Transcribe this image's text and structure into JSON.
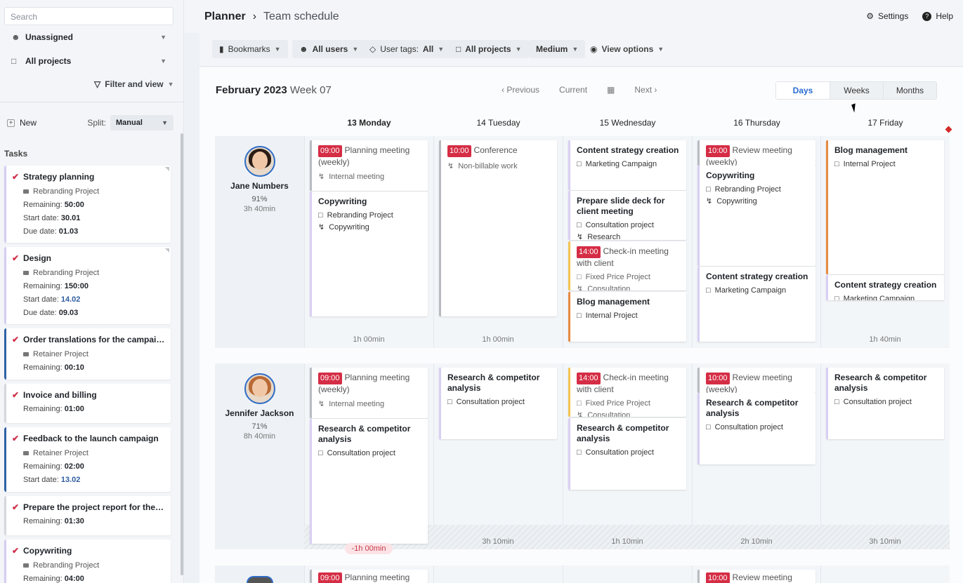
{
  "sidebar": {
    "search_placeholder": "Search",
    "user_filter": "Unassigned",
    "project_filter": "All projects",
    "filter_and_view": "Filter and view",
    "new_label": "New",
    "split_label": "Split:",
    "split_value": "Manual",
    "tasks_heading": "Tasks",
    "tasks": [
      {
        "title": "Strategy planning",
        "project": "Rebranding Project",
        "remaining_label": "Remaining:",
        "remaining": "50:00",
        "start_label": "Start date:",
        "start": "30.01",
        "due_label": "Due date:",
        "due": "01.03"
      },
      {
        "title": "Design",
        "project": "Rebranding Project",
        "remaining_label": "Remaining:",
        "remaining": "150:00",
        "start_label": "Start date:",
        "start": "14.02",
        "due_label": "Due date:",
        "due": "09.03"
      },
      {
        "title": "Order translations for the campaign ...",
        "project": "Retainer Project",
        "remaining_label": "Remaining:",
        "remaining": "00:10"
      },
      {
        "title": "Invoice and billing",
        "remaining_label": "Remaining:",
        "remaining": "01:00"
      },
      {
        "title": "Feedback to the launch campaign",
        "project": "Retainer Project",
        "remaining_label": "Remaining:",
        "remaining": "02:00",
        "start_label": "Start date:",
        "start": "13.02"
      },
      {
        "title": "Prepare the project report for the int...",
        "remaining_label": "Remaining:",
        "remaining": "01:30"
      },
      {
        "title": "Copywriting",
        "project": "Rebranding Project",
        "remaining_label": "Remaining:",
        "remaining": "04:00"
      }
    ]
  },
  "header": {
    "app": "Planner",
    "separator": "›",
    "page": "Team schedule",
    "settings": "Settings",
    "help": "Help"
  },
  "filters": {
    "bookmarks": "Bookmarks",
    "users": "All users",
    "user_tags_label": "User tags:",
    "user_tags_value": "All",
    "projects": "All projects",
    "density": "Medium",
    "view_options": "View options"
  },
  "calendar": {
    "month": "February 2023",
    "week": "Week 07",
    "previous": "Previous",
    "current": "Current",
    "next": "Next",
    "views": [
      "Days",
      "Weeks",
      "Months"
    ],
    "active_view": "Days",
    "days": [
      {
        "num": "13",
        "name": "Monday"
      },
      {
        "num": "14",
        "name": "Tuesday"
      },
      {
        "num": "15",
        "name": "Wednesday"
      },
      {
        "num": "16",
        "name": "Thursday"
      },
      {
        "num": "17",
        "name": "Friday"
      }
    ]
  },
  "people": [
    {
      "name": "Jane Numbers",
      "pct": "91%",
      "hours": "3h 40min",
      "footers": [
        "1h 00min",
        "1h 00min",
        "",
        "",
        "1h 40min"
      ]
    },
    {
      "name": "Jennifer Jackson",
      "pct": "71%",
      "hours": "8h 40min",
      "footers": [
        "-1h 00min",
        "3h 10min",
        "1h 10min",
        "2h 10min",
        "3h 10min"
      ]
    }
  ],
  "cards": {
    "planning": {
      "time": "09:00",
      "title": "Planning meeting (weekly)",
      "sub": "Internal meeting"
    },
    "copywriting": {
      "title": "Copywriting",
      "project": "Rebranding Project",
      "tag": "Copywriting"
    },
    "conference": {
      "time": "10:00",
      "title": "Conference",
      "sub": "Non-billable work"
    },
    "content1": {
      "title": "Content strategy creation",
      "project": "Marketing Campaign"
    },
    "slide": {
      "title": "Prepare slide deck for client meeting",
      "project": "Consultation project",
      "tag": "Research"
    },
    "checkin": {
      "time": "14:00",
      "title": "Check-in meeting with client",
      "project": "Fixed Price Project",
      "tag": "Consultation"
    },
    "blog1": {
      "title": "Blog management",
      "project": "Internal Project"
    },
    "review": {
      "time": "10:00",
      "title": "Review meeting (weekly)"
    },
    "copy2": {
      "title": "Copywriting",
      "project": "Rebranding Project",
      "tag": "Copywriting"
    },
    "content2": {
      "title": "Content strategy creation",
      "project": "Marketing Campaign"
    },
    "blog2": {
      "title": "Blog management",
      "project": "Internal Project"
    },
    "content3": {
      "title": "Content strategy creation",
      "project": "Marketing Campaign"
    },
    "research": {
      "title": "Research & competitor analysis",
      "project": "Consultation project"
    },
    "checkin2": {
      "time": "14:00",
      "title": "Check-in meeting with client",
      "project": "Fixed Price Project",
      "tag": "Consultation"
    },
    "review2": {
      "time": "10:00",
      "title": "Review meeting (weekly)"
    },
    "planning3": {
      "time": "09:00",
      "title": "Planning meeting"
    },
    "review3": {
      "time": "10:00",
      "title": "Review meeting"
    }
  }
}
